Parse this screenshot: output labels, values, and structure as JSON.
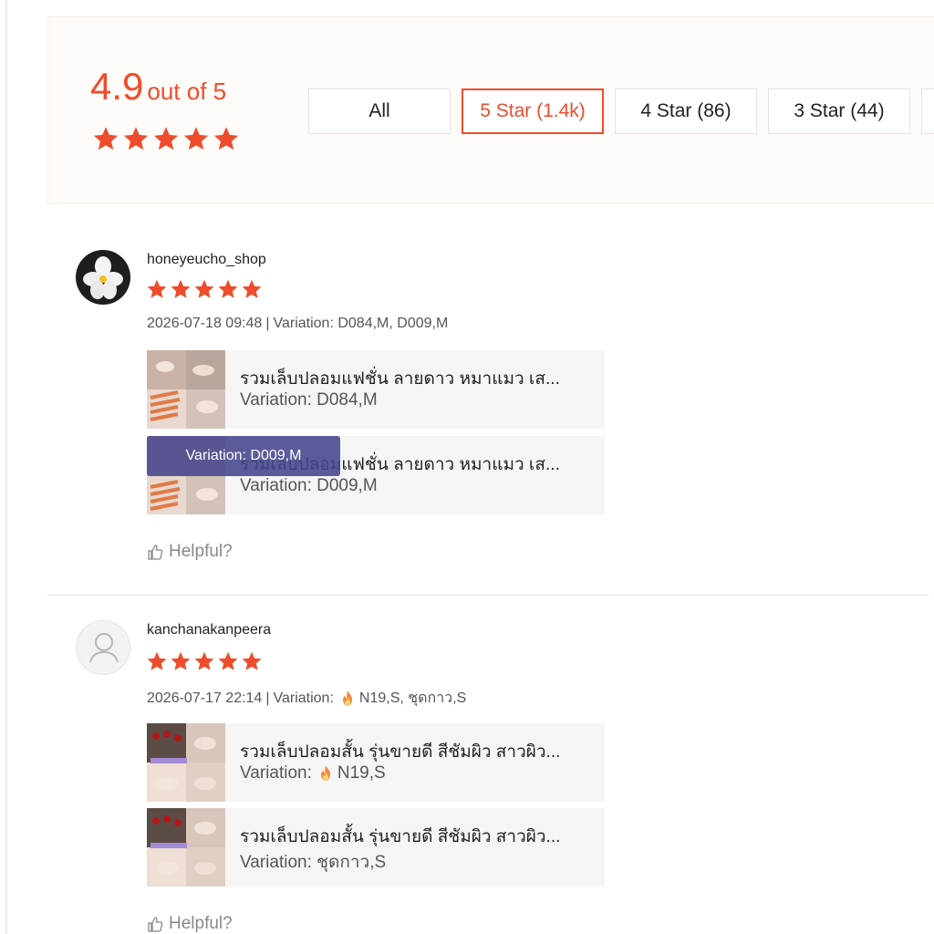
{
  "summary": {
    "score": "4.9",
    "score_suffix": "out of 5",
    "stars": 5,
    "accent_color": "#ee4d2d"
  },
  "filters": [
    {
      "label": "All",
      "active": false
    },
    {
      "label": "5 Star (1.4k)",
      "active": true
    },
    {
      "label": "4 Star (86)",
      "active": false
    },
    {
      "label": "3 Star (44)",
      "active": false
    }
  ],
  "reviews": [
    {
      "username": "honeyeucho_shop",
      "stars": 5,
      "datetime": "2026-07-18 09:48",
      "variation_label": "Variation:",
      "variation_value": "D084,M, D009,M",
      "helpful_label": "Helpful?",
      "overlay_label": "Variation: D009,M",
      "products": [
        {
          "name": "รวมเล็บปลอมแฟชั่น ลายดาว หมาแมว เส...",
          "variation": "Variation: D084,M"
        },
        {
          "name": "รวมเล็บปลอมแฟชั่น ลายดาว หมาแมว เส...",
          "variation": "Variation: D009,M"
        }
      ]
    },
    {
      "username": "kanchanakanpeera",
      "stars": 5,
      "datetime": "2026-07-17 22:14",
      "variation_label": "Variation:",
      "variation_value": "N19,S, ชุดกาว,S",
      "helpful_label": "Helpful?",
      "products": [
        {
          "name": "รวมเล็บปลอมสั้น รุ่นขายดี สีชัมผิว สาวผิว...",
          "variation_prefix": "Variation:",
          "variation_value": "N19,S"
        },
        {
          "name": "รวมเล็บปลอมสั้น รุ่นขายดี สีชัมผิว สาวผิว...",
          "variation": "Variation: ชุดกาว,S"
        }
      ]
    }
  ]
}
